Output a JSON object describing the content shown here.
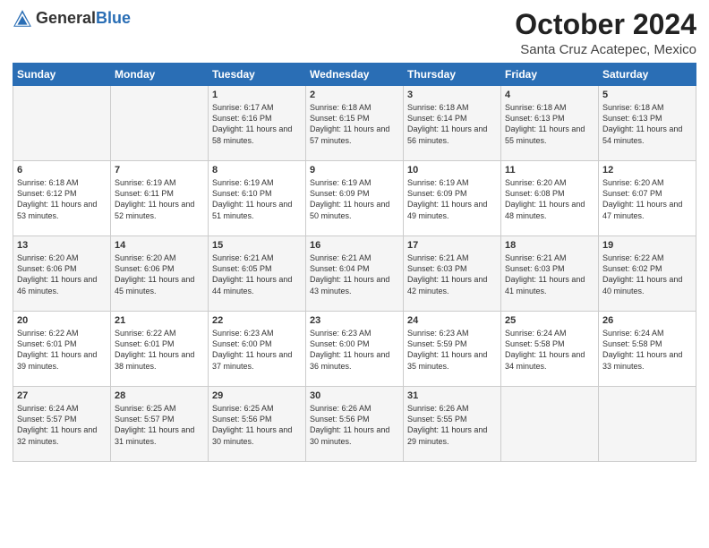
{
  "header": {
    "logo_general": "General",
    "logo_blue": "Blue",
    "month": "October 2024",
    "location": "Santa Cruz Acatepec, Mexico"
  },
  "days_of_week": [
    "Sunday",
    "Monday",
    "Tuesday",
    "Wednesday",
    "Thursday",
    "Friday",
    "Saturday"
  ],
  "weeks": [
    [
      {
        "day": "",
        "info": ""
      },
      {
        "day": "",
        "info": ""
      },
      {
        "day": "1",
        "info": "Sunrise: 6:17 AM\nSunset: 6:16 PM\nDaylight: 11 hours and 58 minutes."
      },
      {
        "day": "2",
        "info": "Sunrise: 6:18 AM\nSunset: 6:15 PM\nDaylight: 11 hours and 57 minutes."
      },
      {
        "day": "3",
        "info": "Sunrise: 6:18 AM\nSunset: 6:14 PM\nDaylight: 11 hours and 56 minutes."
      },
      {
        "day": "4",
        "info": "Sunrise: 6:18 AM\nSunset: 6:13 PM\nDaylight: 11 hours and 55 minutes."
      },
      {
        "day": "5",
        "info": "Sunrise: 6:18 AM\nSunset: 6:13 PM\nDaylight: 11 hours and 54 minutes."
      }
    ],
    [
      {
        "day": "6",
        "info": "Sunrise: 6:18 AM\nSunset: 6:12 PM\nDaylight: 11 hours and 53 minutes."
      },
      {
        "day": "7",
        "info": "Sunrise: 6:19 AM\nSunset: 6:11 PM\nDaylight: 11 hours and 52 minutes."
      },
      {
        "day": "8",
        "info": "Sunrise: 6:19 AM\nSunset: 6:10 PM\nDaylight: 11 hours and 51 minutes."
      },
      {
        "day": "9",
        "info": "Sunrise: 6:19 AM\nSunset: 6:09 PM\nDaylight: 11 hours and 50 minutes."
      },
      {
        "day": "10",
        "info": "Sunrise: 6:19 AM\nSunset: 6:09 PM\nDaylight: 11 hours and 49 minutes."
      },
      {
        "day": "11",
        "info": "Sunrise: 6:20 AM\nSunset: 6:08 PM\nDaylight: 11 hours and 48 minutes."
      },
      {
        "day": "12",
        "info": "Sunrise: 6:20 AM\nSunset: 6:07 PM\nDaylight: 11 hours and 47 minutes."
      }
    ],
    [
      {
        "day": "13",
        "info": "Sunrise: 6:20 AM\nSunset: 6:06 PM\nDaylight: 11 hours and 46 minutes."
      },
      {
        "day": "14",
        "info": "Sunrise: 6:20 AM\nSunset: 6:06 PM\nDaylight: 11 hours and 45 minutes."
      },
      {
        "day": "15",
        "info": "Sunrise: 6:21 AM\nSunset: 6:05 PM\nDaylight: 11 hours and 44 minutes."
      },
      {
        "day": "16",
        "info": "Sunrise: 6:21 AM\nSunset: 6:04 PM\nDaylight: 11 hours and 43 minutes."
      },
      {
        "day": "17",
        "info": "Sunrise: 6:21 AM\nSunset: 6:03 PM\nDaylight: 11 hours and 42 minutes."
      },
      {
        "day": "18",
        "info": "Sunrise: 6:21 AM\nSunset: 6:03 PM\nDaylight: 11 hours and 41 minutes."
      },
      {
        "day": "19",
        "info": "Sunrise: 6:22 AM\nSunset: 6:02 PM\nDaylight: 11 hours and 40 minutes."
      }
    ],
    [
      {
        "day": "20",
        "info": "Sunrise: 6:22 AM\nSunset: 6:01 PM\nDaylight: 11 hours and 39 minutes."
      },
      {
        "day": "21",
        "info": "Sunrise: 6:22 AM\nSunset: 6:01 PM\nDaylight: 11 hours and 38 minutes."
      },
      {
        "day": "22",
        "info": "Sunrise: 6:23 AM\nSunset: 6:00 PM\nDaylight: 11 hours and 37 minutes."
      },
      {
        "day": "23",
        "info": "Sunrise: 6:23 AM\nSunset: 6:00 PM\nDaylight: 11 hours and 36 minutes."
      },
      {
        "day": "24",
        "info": "Sunrise: 6:23 AM\nSunset: 5:59 PM\nDaylight: 11 hours and 35 minutes."
      },
      {
        "day": "25",
        "info": "Sunrise: 6:24 AM\nSunset: 5:58 PM\nDaylight: 11 hours and 34 minutes."
      },
      {
        "day": "26",
        "info": "Sunrise: 6:24 AM\nSunset: 5:58 PM\nDaylight: 11 hours and 33 minutes."
      }
    ],
    [
      {
        "day": "27",
        "info": "Sunrise: 6:24 AM\nSunset: 5:57 PM\nDaylight: 11 hours and 32 minutes."
      },
      {
        "day": "28",
        "info": "Sunrise: 6:25 AM\nSunset: 5:57 PM\nDaylight: 11 hours and 31 minutes."
      },
      {
        "day": "29",
        "info": "Sunrise: 6:25 AM\nSunset: 5:56 PM\nDaylight: 11 hours and 30 minutes."
      },
      {
        "day": "30",
        "info": "Sunrise: 6:26 AM\nSunset: 5:56 PM\nDaylight: 11 hours and 30 minutes."
      },
      {
        "day": "31",
        "info": "Sunrise: 6:26 AM\nSunset: 5:55 PM\nDaylight: 11 hours and 29 minutes."
      },
      {
        "day": "",
        "info": ""
      },
      {
        "day": "",
        "info": ""
      }
    ]
  ]
}
